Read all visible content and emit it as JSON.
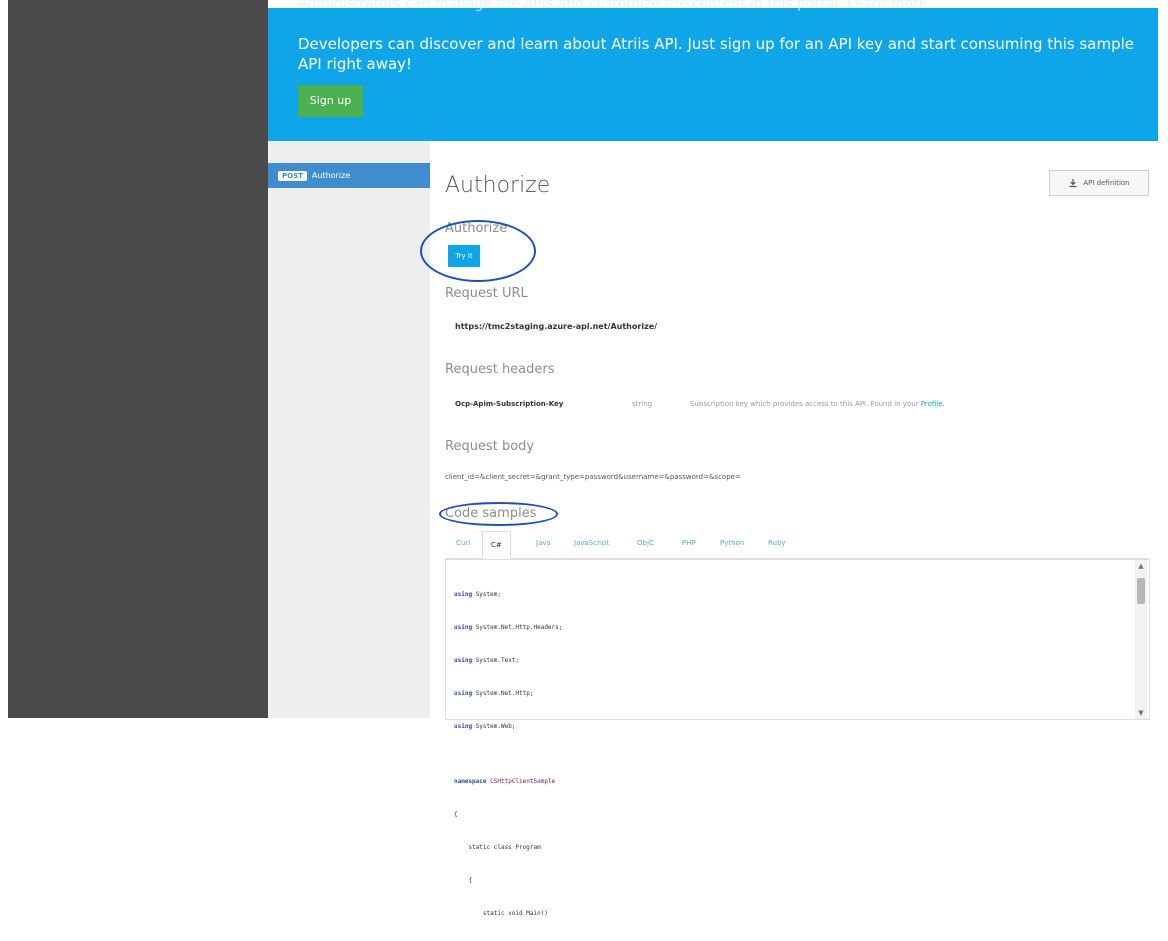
{
  "hero": {
    "top_cut_text": "Administrators can manage the APIs and customize the content in this portal. Learn more",
    "intro_text": "Developers can discover and learn about Atriis API. Just sign up for an API key and start consuming this sample API right away!",
    "signup_label": "Sign up"
  },
  "sidebar": {
    "method": "POST",
    "label": "Authorize"
  },
  "main": {
    "title": "Authorize",
    "api_definition_label": "API definition",
    "operation_title": "Authorize",
    "try_label": "Try it",
    "request_url_label": "Request URL",
    "request_url": "https://tmc2staging.azure-api.net/Authorize/",
    "headers_label": "Request headers",
    "header_key": "Ocp-Apim-Subscription-Key",
    "header_type": "string",
    "header_desc_prefix": "Subscription key which provides access to this API. Found in your",
    "header_desc_link": "Profile.",
    "request_body_label": "Request body",
    "request_body": "client_id=&client_secret=&grant_type=password&username=&password=&scope=",
    "code_samples_label": "Code samples",
    "tabs": [
      "Curl",
      "C#",
      "Java",
      "JavaScript",
      "ObjC",
      "PHP",
      "Python",
      "Ruby"
    ],
    "code": [
      "using System;",
      "using System.Net.Http.Headers;",
      "using System.Text;",
      "using System.Net.Http;",
      "using System.Web;",
      "",
      "namespace CSHttpClientSample",
      "{",
      "    static class Program",
      "    {",
      "        static void Main()"
    ]
  },
  "colors": {
    "hero_bg": "#0ea5e9",
    "signup_bg": "#4caf50",
    "sidebar_active": "#3f8ccf",
    "annotation": "#1f4fbf"
  }
}
